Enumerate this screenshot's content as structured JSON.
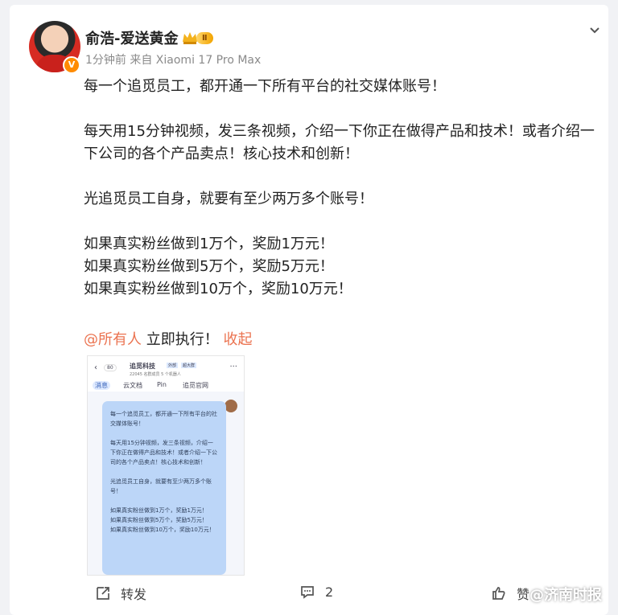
{
  "post": {
    "username": "俞浩-爱送黄金",
    "level": "Ⅱ",
    "meta": "1分钟前  来自 Xiaomi 17 Pro Max",
    "content": "每一个追觅员工，都开通一下所有平台的社交媒体账号！\n\n每天用15分钟视频，发三条视频，介绍一下你正在做得产品和技术！或者介绍一下公司的各个产品卖点！核心技术和创新！\n\n光追觅员工自身，就要有至少两万多个账号！\n\n如果真实粉丝做到1万个，奖励1万元！\n如果真实粉丝做到5万个，奖励5万元！\n如果真实粉丝做到10万个，奖励10万元！",
    "mention": "@所有人",
    "after_mention": " 立即执行！ ",
    "collapse": "收起"
  },
  "screenshot": {
    "top_left": "80",
    "group": "追觅科技",
    "group_tag": "外部",
    "group_tag_2": "超大群",
    "members": "22045 名群成员   5 个机器人",
    "menu": "···",
    "toolbar": [
      "消息",
      "云文档",
      "Pin",
      "追觅官网"
    ],
    "message": "每一个追觅员工，都开通一下所有平台的社交媒体账号！\n\n每天用15分钟视频，发三条视频，介绍一下你正在做得产品和技术！或者介绍一下公司的各个产品卖点！核心技术和创新！\n\n光追觅员工自身，就要有至少两万多个账号！\n\n如果真实粉丝做到1万个，奖励1万元！\n如果真实粉丝做到5万个，奖励5万元！\n如果真实粉丝做到10万个，奖励10万元！"
  },
  "actions": {
    "repost": "转发",
    "comments": "2",
    "likes": "赞"
  },
  "watermark": "@济南时报",
  "colors": {
    "accent": "#eb7350",
    "bubble": "#bcd6f8"
  }
}
